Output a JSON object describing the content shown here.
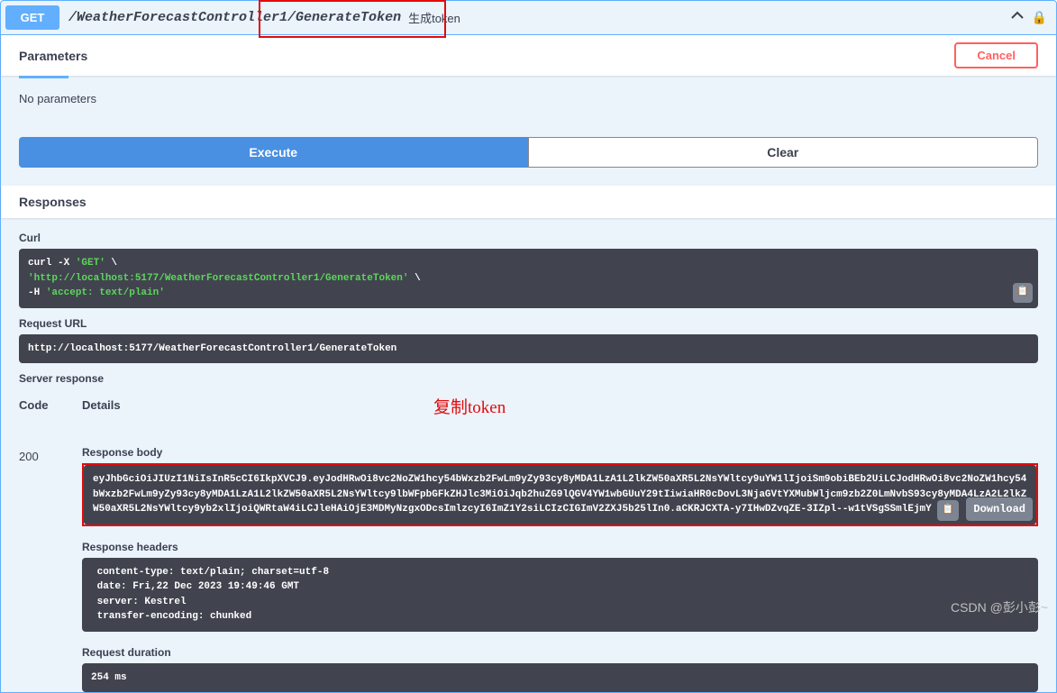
{
  "operation": {
    "method": "GET",
    "path_part1": "/WeatherForecastController1",
    "path_part2": "/GenerateToken",
    "summary": "生成token"
  },
  "sections": {
    "parameters": "Parameters",
    "cancel": "Cancel",
    "no_params": "No parameters",
    "execute": "Execute",
    "clear": "Clear",
    "responses": "Responses"
  },
  "curl": {
    "heading": "Curl",
    "line1a": "curl -X ",
    "line1b": "'GET'",
    "line1c": " \\",
    "line2a": "  ",
    "line2b": "'http://localhost:5177/WeatherForecastController1/GenerateToken'",
    "line2c": " \\",
    "line3a": "  -H ",
    "line3b": "'accept: text/plain'"
  },
  "request_url": {
    "heading": "Request URL",
    "value": "http://localhost:5177/WeatherForecastController1/GenerateToken"
  },
  "server_response": {
    "heading": "Server response",
    "code_label": "Code",
    "details_label": "Details",
    "code": "200"
  },
  "annotation": {
    "copy_token": "复制token"
  },
  "response_body": {
    "heading": "Response body",
    "download": "Download",
    "token": "eyJhbGciOiJIUzI1NiIsInR5cCI6IkpXVCJ9.eyJodHRwOi8vc2NoZW1hcy54bWxzb2FwLm9yZy93cy8yMDA1LzA1L2lkZW50aXR5L2NsYWltcy9uYW1lIjoiSm9obiBEb2UiLCJodHRwOi8vc2NoZW1hcy54bWxzb2FwLm9yZy93cy8yMDA1LzA1L2lkZW50aXR5L2NsYWltcy9lbWFpbGFkZHJlc3MiOiJqb2huZG9lQGV4YW1wbGUuY29tIiwiaHR0cDovL3NjaGVtYXMubWljcm9zb2Z0LmNvbS93cy8yMDA4LzA2L2lkZW50aXR5L2NsYWltcy9yb2xlIjoiQWRtaW4iLCJleHAiOjE3MDMyNzgxODcsImlzcyI6ImZ1Y2siLCIzCIGImV2ZXJ5b25lIn0.aCKRJCXTA-y7IHwDZvqZE-3IZpl--w1tVSgSSmlEjmY"
  },
  "response_headers": {
    "heading": "Response headers",
    "lines": " content-type: text/plain; charset=utf-8 \n date: Fri,22 Dec 2023 19:49:46 GMT \n server: Kestrel \n transfer-encoding: chunked "
  },
  "request_duration": {
    "heading": "Request duration",
    "value": " 254 ms"
  },
  "watermark": "CSDN @彭小彭~"
}
